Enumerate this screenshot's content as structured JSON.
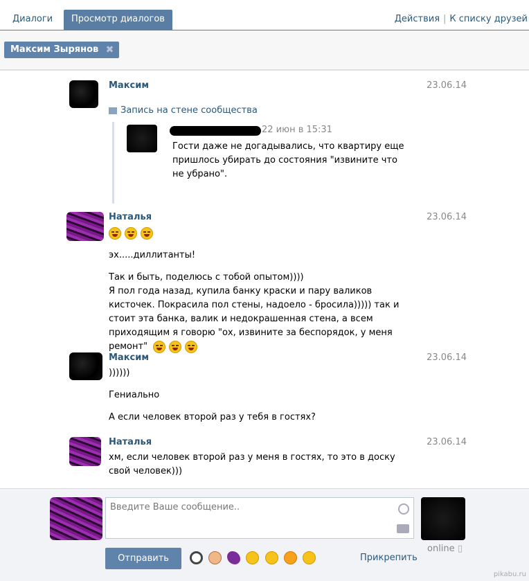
{
  "tabs": {
    "dialogs": "Диалоги",
    "view_dialogs": "Просмотр диалогов",
    "actions": "Действия",
    "separator": "|",
    "to_friends": "К списку друзей"
  },
  "filter": {
    "chip_label": "Максим Зырянов",
    "chip_close": "✖"
  },
  "messages": [
    {
      "author": "Максим",
      "date": "23.06.14",
      "wall_link": "Запись на стене сообщества",
      "quote": {
        "date": "22 июн в 15:31",
        "text": "Гости даже не догадывались, что квартиру еще пришлось убирать до состояния \"извините что не убрано\"."
      }
    },
    {
      "author": "Наталья",
      "date": "23.06.14",
      "line1": "эх.....диллитанты!",
      "line2": "Так и быть, поделюсь с тобой опытом))))",
      "line3": "Я пол года назад, купила банку краски и пару валиков кисточек. Покрасила пол стены, надоело - бросила))))) так и стоит эта банка, валик и недокрашенная стена, а всем приходящим я говорю \"ох, извините за беспорядок, у меня ремонт\""
    },
    {
      "author": "Максим",
      "date": "23.06.14",
      "line1": "))))))",
      "line2": "Гениально",
      "line3": "А если человек второй раз у тебя в гостях?"
    },
    {
      "author": "Наталья",
      "date": "23.06.14",
      "line1": "хм, если человек второй раз у меня в гостях, то это в доску свой человек)))"
    }
  ],
  "composer": {
    "placeholder": "Введите Ваше сообщение..",
    "send_label": "Отправить",
    "attach_label": "Прикрепить",
    "online_label": "online"
  },
  "watermark": "pikabu.ru"
}
